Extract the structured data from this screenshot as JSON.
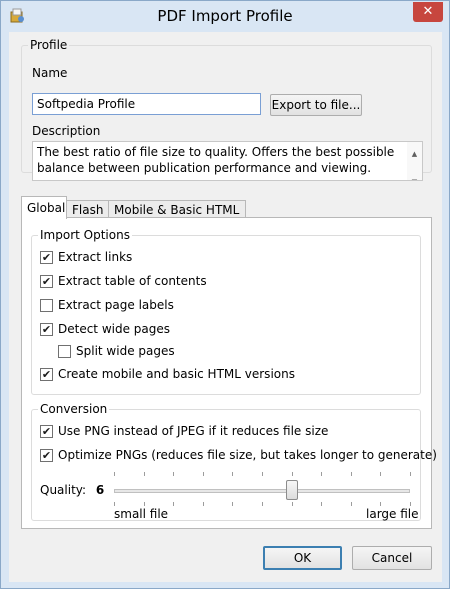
{
  "window": {
    "title": "PDF Import Profile",
    "close_label": "✕"
  },
  "profile": {
    "group_label": "Profile",
    "name_label": "Name",
    "name_value": "Softpedia Profile",
    "export_label": "Export to file...",
    "description_label": "Description",
    "description_text": "The best ratio of file size to quality. Offers the best possible balance between publication performance and viewing."
  },
  "tabs": [
    {
      "label": "Global",
      "active": true
    },
    {
      "label": "Flash",
      "active": false
    },
    {
      "label": "Mobile & Basic HTML",
      "active": false
    }
  ],
  "import_options": {
    "group_label": "Import Options",
    "items": [
      {
        "label": "Extract links",
        "checked": true
      },
      {
        "label": "Extract table of contents",
        "checked": true
      },
      {
        "label": "Extract page labels",
        "checked": false
      },
      {
        "label": "Detect wide pages",
        "checked": true
      },
      {
        "label": "Split wide pages",
        "checked": false
      },
      {
        "label": "Create mobile and basic HTML versions",
        "checked": true
      }
    ]
  },
  "conversion": {
    "group_label": "Conversion",
    "items": [
      {
        "label": "Use PNG instead of JPEG if it reduces file size",
        "checked": true
      },
      {
        "label": "Optimize PNGs (reduces file size, but takes longer to generate)",
        "checked": true
      }
    ],
    "quality_label": "Quality:",
    "quality_value": "6",
    "quality_min": 0,
    "quality_max": 10,
    "small_label": "small file",
    "large_label": "large file"
  },
  "buttons": {
    "ok": "OK",
    "cancel": "Cancel"
  },
  "check_glyph": "✔"
}
